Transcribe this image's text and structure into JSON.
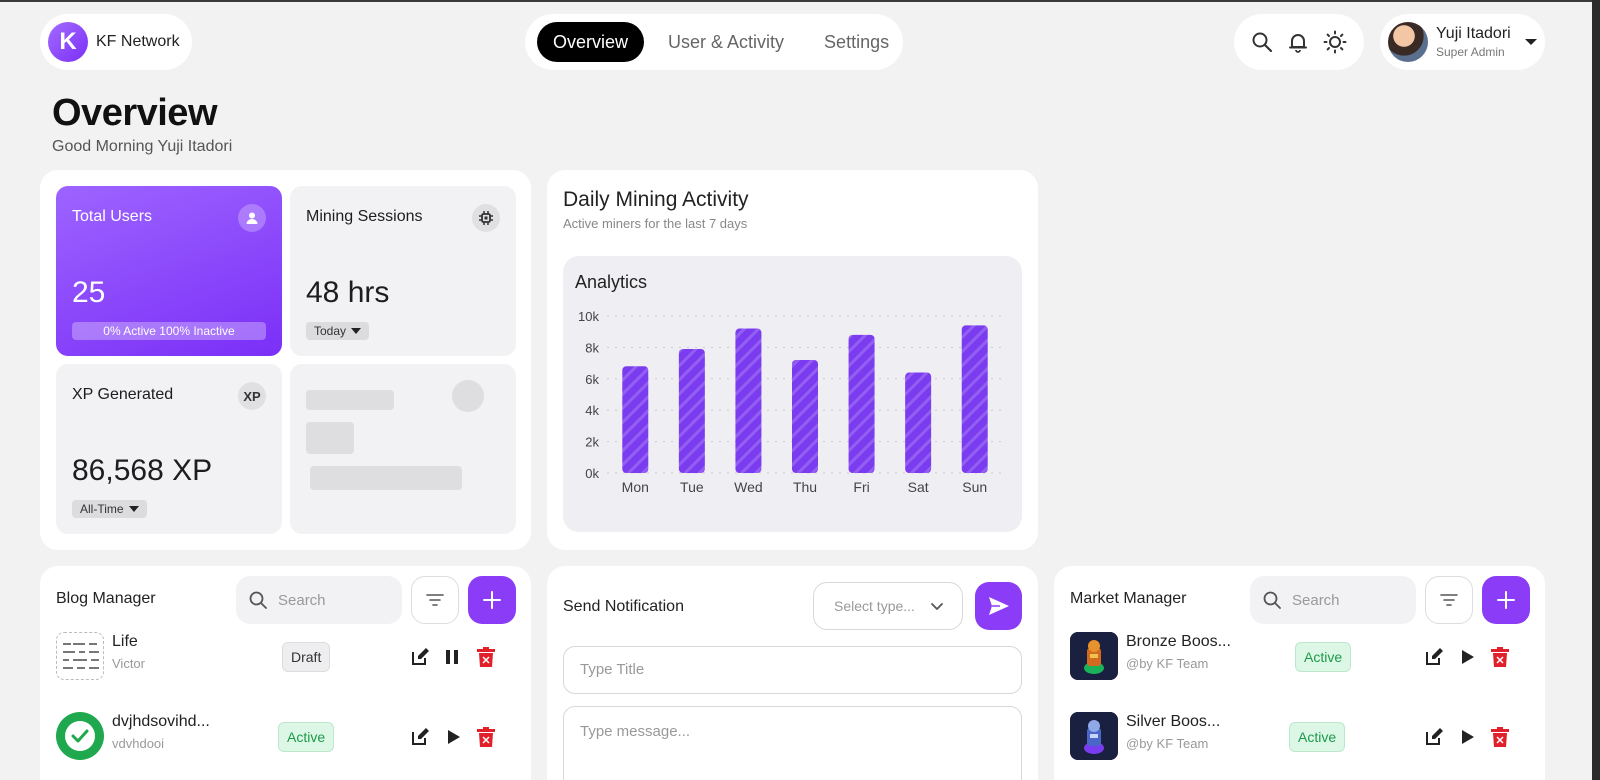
{
  "brand": {
    "logo_letter": "K",
    "name": "KF Network"
  },
  "nav": {
    "tabs": [
      {
        "label": "Overview"
      },
      {
        "label": "User & Activity"
      },
      {
        "label": "Settings"
      }
    ],
    "active": "Overview"
  },
  "toolbar": {
    "icons": [
      "search-icon",
      "bell-icon",
      "sun-icon"
    ]
  },
  "user": {
    "name": "Yuji Itadori",
    "role": "Super Admin"
  },
  "page": {
    "title": "Overview",
    "greeting": "Good Morning Yuji Itadori"
  },
  "stats": {
    "total_users": {
      "label": "Total Users",
      "value": "25",
      "sub": "0% Active 100% Inactive"
    },
    "mining_sessions": {
      "label": "Mining Sessions",
      "value": "48 hrs",
      "filter": "Today"
    },
    "xp_generated": {
      "label": "XP Generated",
      "icon_text": "XP",
      "value": "86,568 XP",
      "filter": "All-Time"
    }
  },
  "chart_panel": {
    "title": "Daily Mining Activity",
    "subtitle": "Active miners for the last 7 days",
    "box_title": "Analytics"
  },
  "chart_data": {
    "type": "bar",
    "categories": [
      "Mon",
      "Tue",
      "Wed",
      "Thu",
      "Fri",
      "Sat",
      "Sun"
    ],
    "values": [
      6800,
      7900,
      9200,
      7200,
      8800,
      6400,
      9400
    ],
    "yticks": [
      "0k",
      "2k",
      "4k",
      "6k",
      "8k",
      "10k"
    ],
    "ylim": [
      0,
      10000
    ],
    "bar_color": "#7b3cf0",
    "grid": "dotted horizontal"
  },
  "blog": {
    "title": "Blog Manager",
    "search_placeholder": "Search",
    "rows": [
      {
        "name": "Life",
        "author": "Victor",
        "status": "Draft"
      },
      {
        "name": "dvjhdsovihd...",
        "author": "vdvhdooi",
        "status": "Active"
      }
    ]
  },
  "notification": {
    "title": "Send Notification",
    "select_placeholder": "Select type...",
    "title_placeholder": "Type Title",
    "message_placeholder": "Type message..."
  },
  "market": {
    "title": "Market Manager",
    "search_placeholder": "Search",
    "rows": [
      {
        "name": "Bronze Boos...",
        "by": "@by KF Team",
        "status": "Active"
      },
      {
        "name": "Silver Boos...",
        "by": "@by KF Team",
        "status": "Active"
      }
    ]
  },
  "colors": {
    "accent": "#8b3cf7",
    "active_green": "#1d9a4a",
    "delete_red": "#e0202a"
  }
}
